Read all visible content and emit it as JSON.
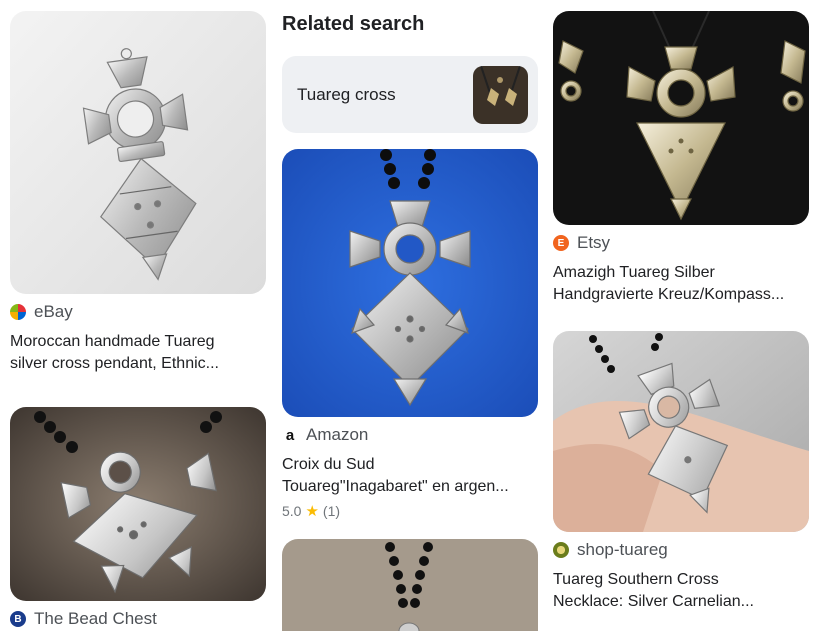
{
  "column1": {
    "result1": {
      "source": "eBay",
      "title_line1": "Moroccan handmade Tuareg",
      "title_line2": "silver cross pendant, Ethnic...",
      "image_alt": "Silver Tuareg cross pendant on white background"
    },
    "result2": {
      "source": "The Bead Chest",
      "image_alt": "Silver Tuareg cross on black beaded cord",
      "favicon_letter": "B"
    }
  },
  "column2": {
    "related": {
      "heading": "Related search",
      "chip_label": "Tuareg cross"
    },
    "result1": {
      "source": "Amazon",
      "title_line1": "Croix du Sud",
      "title_line2": "Touareg\"Inagabaret\" en argen...",
      "rating_value": "5.0",
      "rating_star": "★",
      "rating_count": "(1)",
      "favicon_letter": "a"
    }
  },
  "column3": {
    "result1": {
      "source": "Etsy",
      "title_line1": "Amazigh Tuareg Silber",
      "title_line2": "Handgravierte Kreuz/Kompass...",
      "favicon_letter": "E"
    },
    "result2": {
      "source": "shop-tuareg",
      "title_line1": "Tuareg Southern Cross",
      "title_line2": "Necklace: Silver Carnelian..."
    }
  },
  "colors": {
    "ebay_favicon": "#e53238",
    "etsy_favicon": "#f1641e",
    "bead_chest_favicon": "#1a3c8c",
    "shop_tuareg_favicon": "#6b7d1c",
    "star": "#fbbc04",
    "chip_bg": "#eef0f3"
  }
}
